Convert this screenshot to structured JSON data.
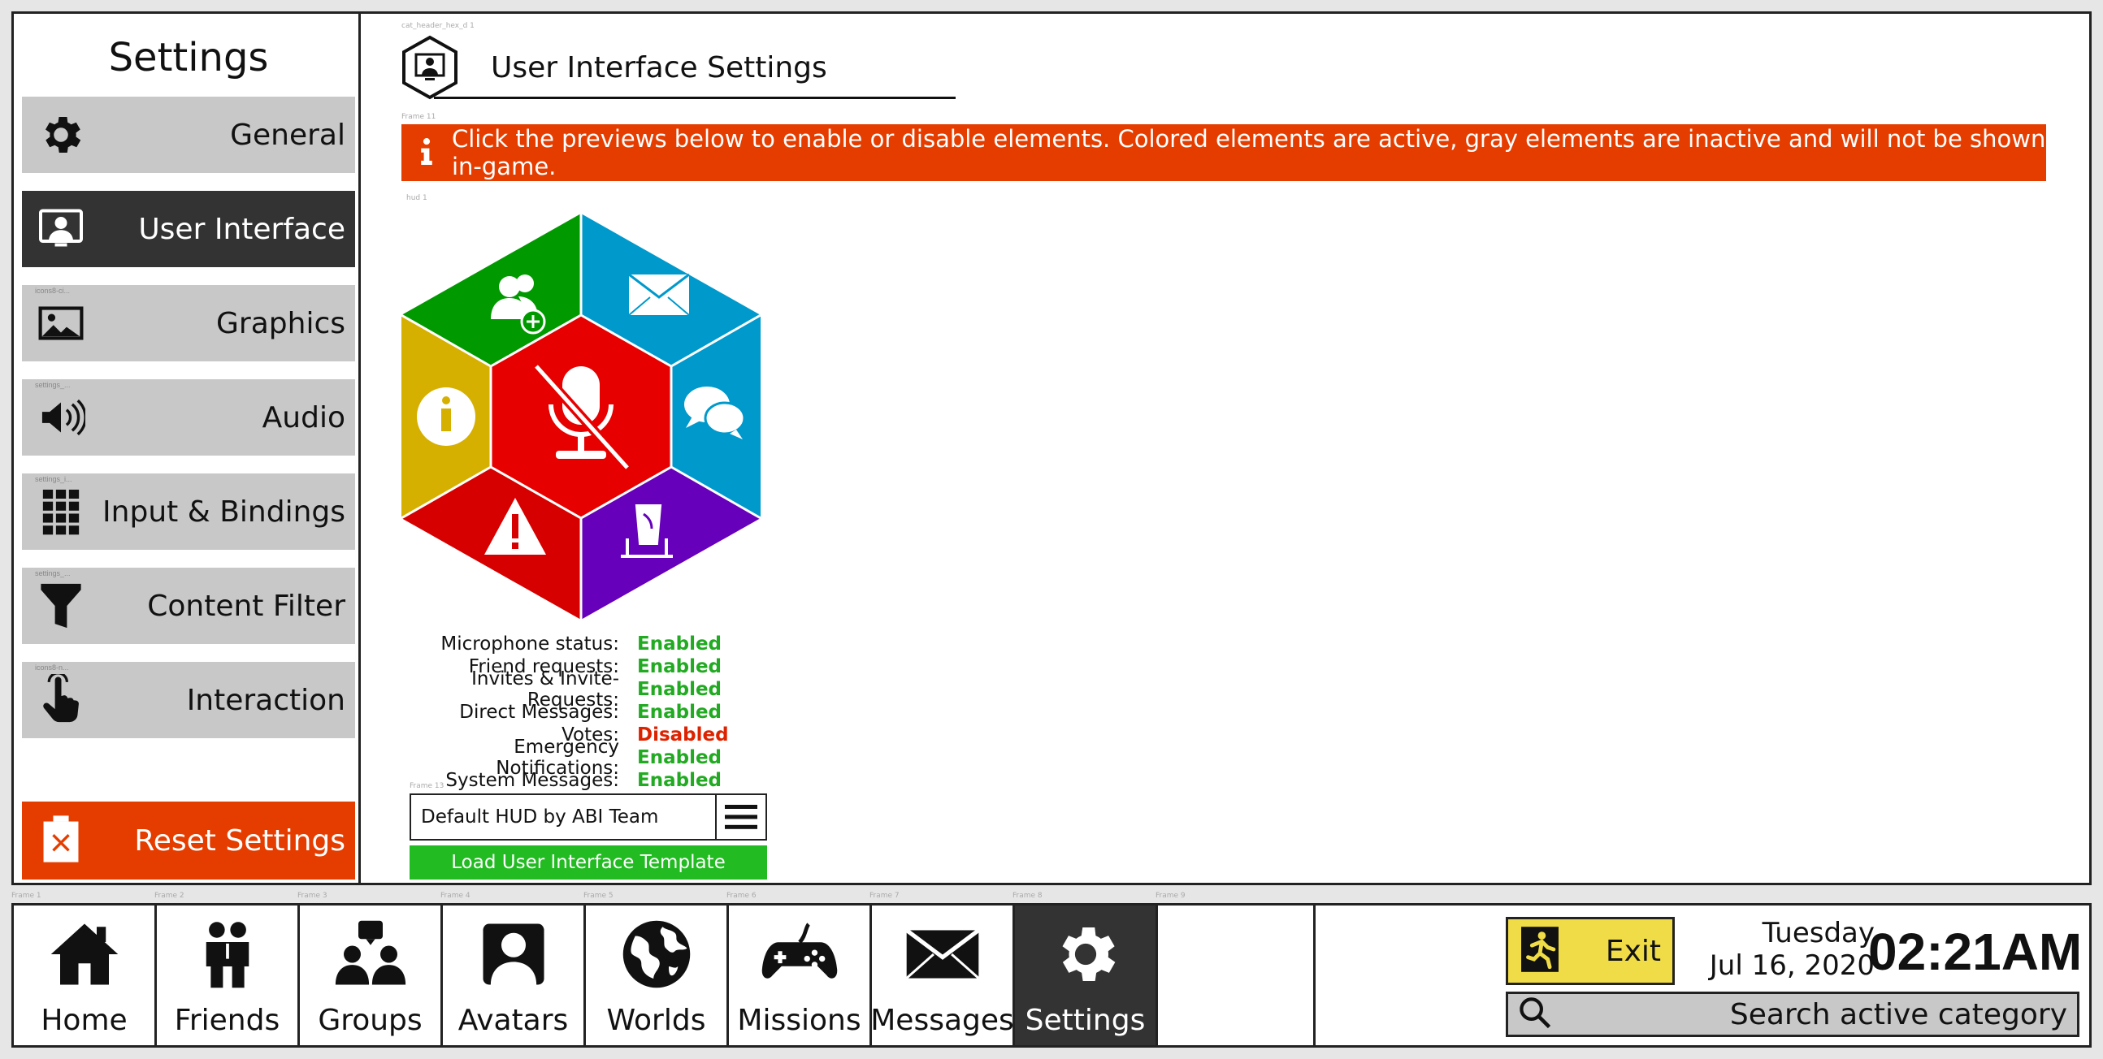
{
  "sidebar": {
    "title": "Settings",
    "items": [
      {
        "label": "General"
      },
      {
        "label": "User Interface"
      },
      {
        "label": "Graphics"
      },
      {
        "label": "Audio"
      },
      {
        "label": "Input & Bindings"
      },
      {
        "label": "Content Filter"
      },
      {
        "label": "Interaction"
      }
    ],
    "reset_label": "Reset Settings"
  },
  "main": {
    "title": "User Interface Settings",
    "info_text": "Click the previews below to enable or disable elements. Colored elements are active, gray elements are inactive and will not be shown in-game.",
    "hud_colors": {
      "friends": "#009900",
      "messages": "#0099cc",
      "chat": "#0099cc",
      "info": "#d6b000",
      "mic_center": "#e60000",
      "emergency": "#d60000",
      "votes": "#6600bb"
    },
    "status": [
      {
        "label": "Microphone status:",
        "value": "Enabled"
      },
      {
        "label": "Friend requests:",
        "value": "Enabled"
      },
      {
        "label": "Invites & Invite-Requests:",
        "value": "Enabled"
      },
      {
        "label": "Direct Messages:",
        "value": "Enabled"
      },
      {
        "label": "Votes:",
        "value": "Disabled"
      },
      {
        "label": "Emergency Notifications:",
        "value": "Enabled"
      },
      {
        "label": "System Messages:",
        "value": "Enabled"
      }
    ],
    "template_value": "Default HUD by ABI Team",
    "load_label": "Load User Interface Template"
  },
  "nav": {
    "items": [
      {
        "label": "Home"
      },
      {
        "label": "Friends"
      },
      {
        "label": "Groups"
      },
      {
        "label": "Avatars"
      },
      {
        "label": "Worlds"
      },
      {
        "label": "Missions"
      },
      {
        "label": "Messages"
      },
      {
        "label": "Settings"
      }
    ]
  },
  "status_bar": {
    "exit_label": "Exit",
    "day": "Tuesday",
    "date": "Jul 16, 2020",
    "time": "02:21AM",
    "search_placeholder": "Search active category"
  },
  "colors": {
    "accent_red": "#e53d00",
    "active_dark": "#333333",
    "inactive_gray": "#c8c8c8",
    "enabled_green": "#22aa22",
    "disabled_red": "#dd2200",
    "exit_yellow": "#f0dc46"
  }
}
